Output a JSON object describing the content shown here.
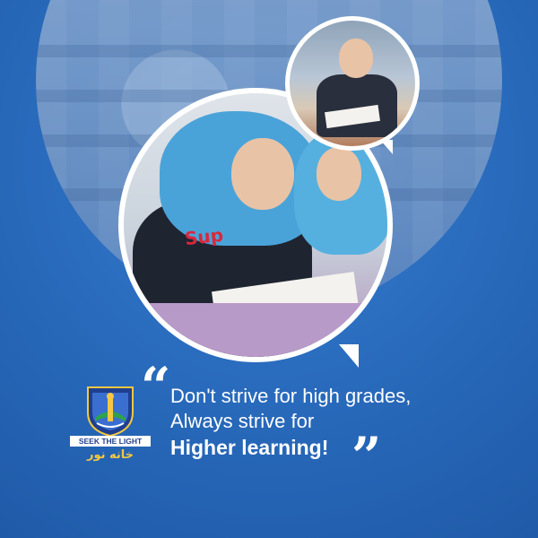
{
  "quote": {
    "line1": "Don't strive for high grades,",
    "line2": "Always strive for",
    "line3": "Higher learning!",
    "open_mark": "“",
    "close_mark": "”"
  },
  "logo": {
    "motto": "SEEK THE LIGHT",
    "arabic_name": "خانه نور",
    "icon": "shield-crest-icon"
  },
  "photos": {
    "main": "students-writing-photo",
    "small": "boy-at-desk-photo",
    "background": "classroom-photo"
  },
  "colors": {
    "background": "#2a6cbe",
    "text": "#ffffff",
    "logo_gold": "#f4c842",
    "logo_blue": "#1f3f8f"
  }
}
